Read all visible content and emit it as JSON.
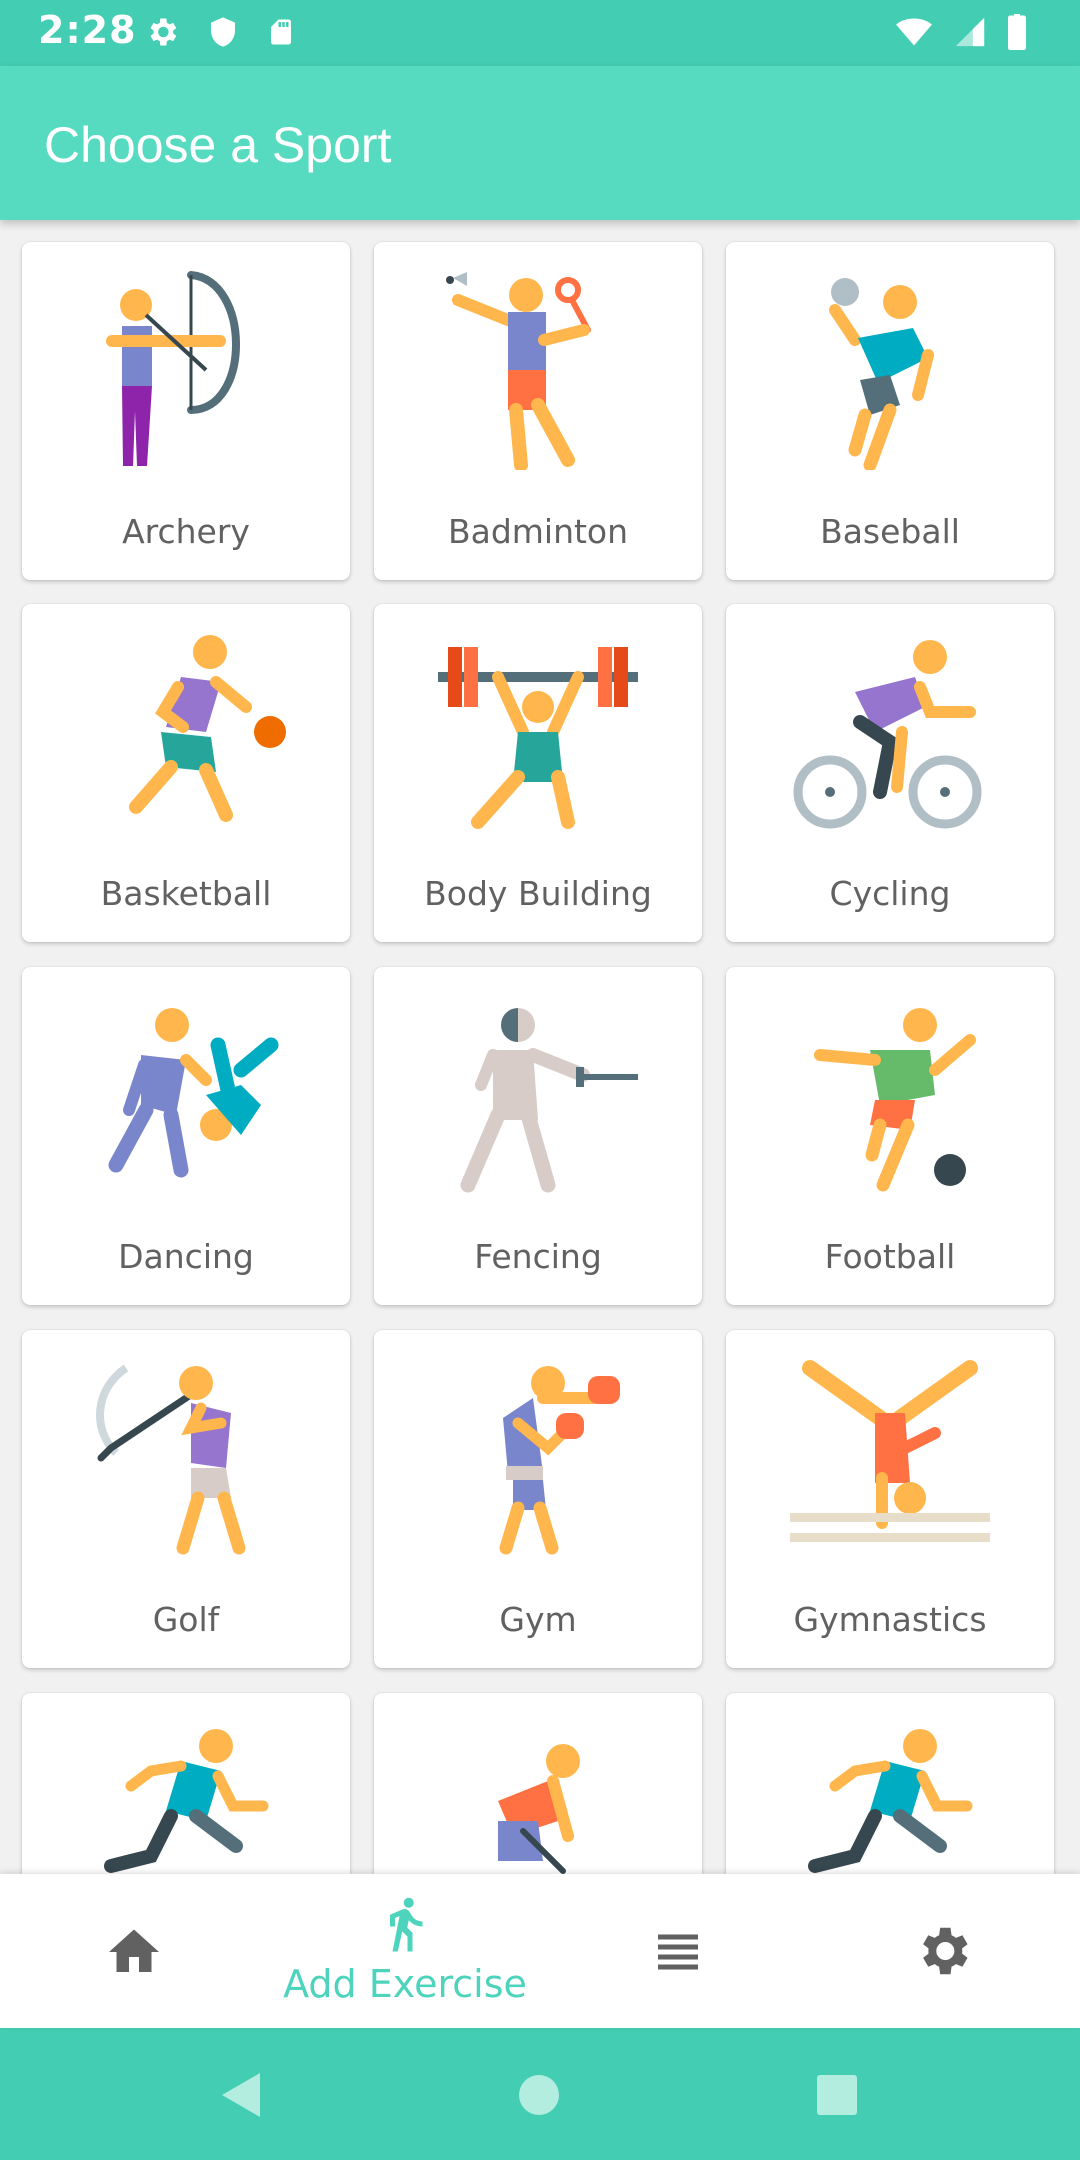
{
  "status_bar": {
    "time": "2:28"
  },
  "app_bar": {
    "title": "Choose a Sport"
  },
  "sports": [
    {
      "label": "Archery"
    },
    {
      "label": "Badminton"
    },
    {
      "label": "Baseball"
    },
    {
      "label": "Basketball"
    },
    {
      "label": "Body Building"
    },
    {
      "label": "Cycling"
    },
    {
      "label": "Dancing"
    },
    {
      "label": "Fencing"
    },
    {
      "label": "Football"
    },
    {
      "label": "Golf"
    },
    {
      "label": "Gym"
    },
    {
      "label": "Gymnastics"
    }
  ],
  "bottom_nav": {
    "add_exercise_label": "Add Exercise"
  },
  "colors": {
    "primary": "#56dbc1",
    "status": "#43cdb2",
    "accent": "#4ed4bc"
  }
}
